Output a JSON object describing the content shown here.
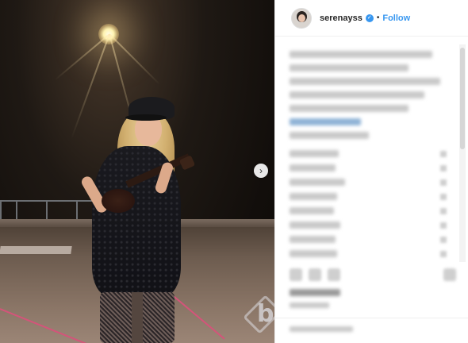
{
  "header": {
    "username": "serenayss",
    "verified_icon": "verified-badge-icon",
    "separator": "•",
    "follow_label": "Follow"
  },
  "photo": {
    "next_arrow": "›",
    "watermark_text": "b"
  },
  "icons": {
    "next": "chevron-right-icon",
    "like": "heart-icon",
    "comment": "comment-icon",
    "share": "share-icon",
    "save": "bookmark-icon"
  },
  "colors": {
    "accent": "#3897f0",
    "text": "#262626"
  }
}
